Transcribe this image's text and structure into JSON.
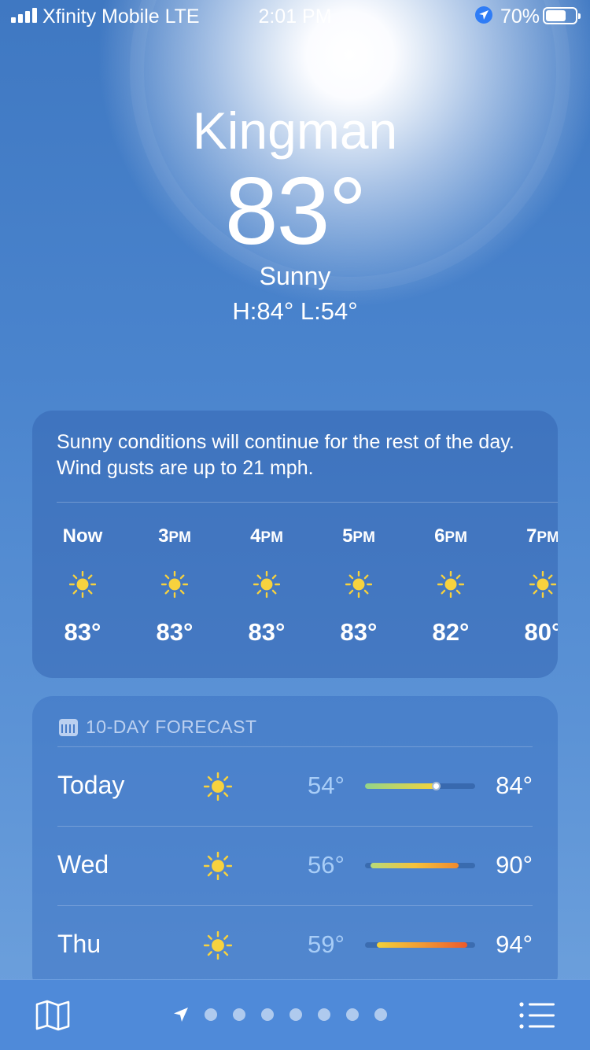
{
  "status_bar": {
    "carrier": "Xfinity Mobile  LTE",
    "time": "2:01 PM",
    "battery_percent": "70%",
    "battery_level": 0.7,
    "signal_bars": 4
  },
  "current": {
    "city": "Kingman",
    "temperature": "83°",
    "condition": "Sunny",
    "high_low": "H:84°  L:54°"
  },
  "hourly_card": {
    "summary": "Sunny conditions will continue for the rest of the day. Wind gusts are up to 21 mph.",
    "hours": [
      {
        "num": "Now",
        "suffix": "",
        "temp": "83°",
        "icon": "sun-icon"
      },
      {
        "num": "3",
        "suffix": "PM",
        "temp": "83°",
        "icon": "sun-icon"
      },
      {
        "num": "4",
        "suffix": "PM",
        "temp": "83°",
        "icon": "sun-icon"
      },
      {
        "num": "5",
        "suffix": "PM",
        "temp": "83°",
        "icon": "sun-icon"
      },
      {
        "num": "6",
        "suffix": "PM",
        "temp": "82°",
        "icon": "sun-icon"
      },
      {
        "num": "7",
        "suffix": "PM",
        "temp": "80°",
        "icon": "sun-icon"
      }
    ]
  },
  "forecast_card": {
    "header": "10-DAY FORECAST",
    "days": [
      {
        "day": "Today",
        "low": "54°",
        "high": "84°",
        "icon": "sun-icon",
        "current": "83°"
      },
      {
        "day": "Wed",
        "low": "56°",
        "high": "90°",
        "icon": "sun-icon"
      },
      {
        "day": "Thu",
        "low": "59°",
        "high": "94°",
        "icon": "sun-icon"
      }
    ]
  },
  "tab_bar": {
    "left_icon": "map-icon",
    "right_icon": "list-icon",
    "page_count": 8,
    "current_page": 0
  },
  "colors": {
    "sun": "#f7d23e",
    "low_temp": "#a8cdf7",
    "location_badge": "#2f7cf6",
    "tab_bar": "#4f8ad9"
  }
}
